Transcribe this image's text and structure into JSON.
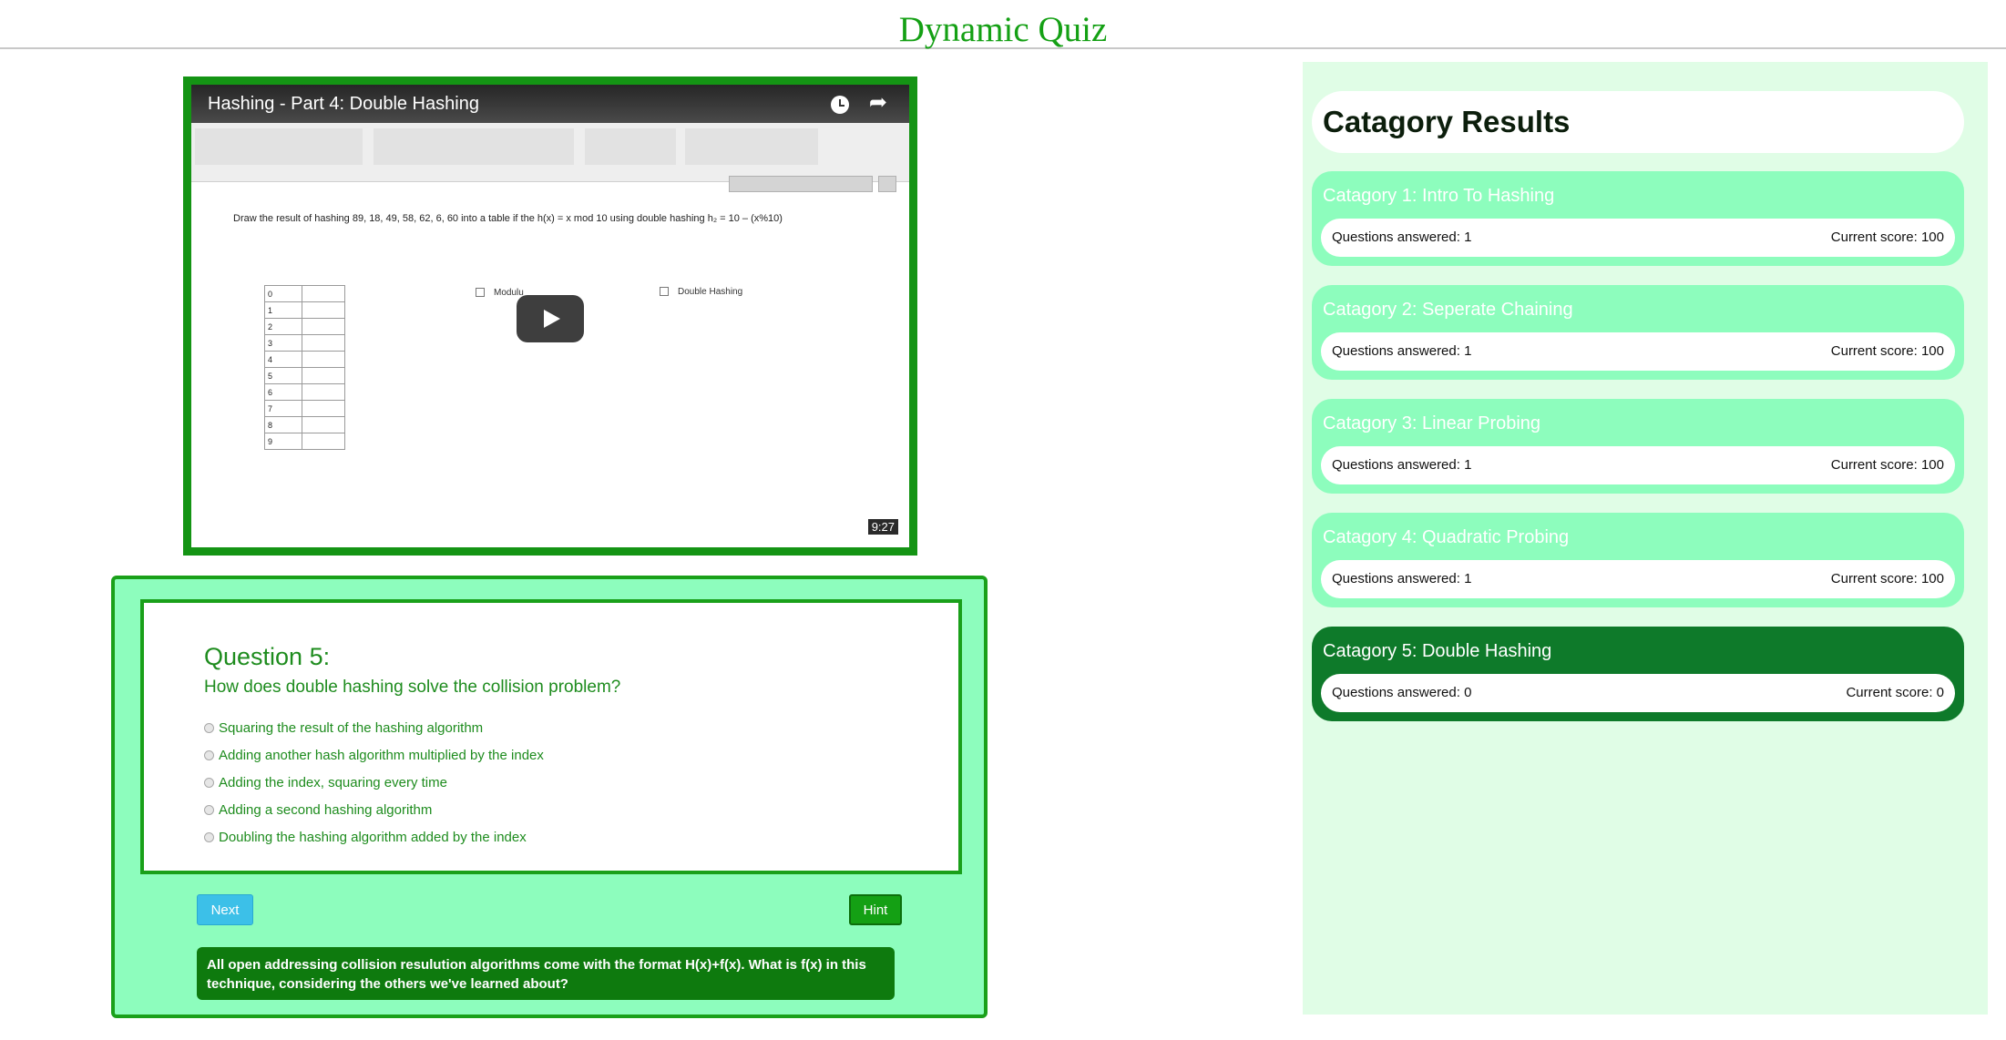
{
  "header": {
    "title": "Dynamic Quiz"
  },
  "video": {
    "title": "Hashing - Part 4: Double Hashing",
    "slide_text": "Draw the result of hashing 89, 18, 49, 58, 62, 6, 60 into a table if the h(x) = x mod 10 using double hashing  h₂ = 10 – (x%10)",
    "table_rows": [
      "0",
      "1",
      "2",
      "3",
      "4",
      "5",
      "6",
      "7",
      "8",
      "9"
    ],
    "label_modulus": "Modulu",
    "label_double_hashing": "Double Hashing",
    "duration": "9:27"
  },
  "quiz": {
    "heading": "Question 5:",
    "question": "How does double hashing solve the collision problem?",
    "answers": [
      "Squaring the result of the hashing algorithm",
      "Adding another hash algorithm multiplied by the index",
      "Adding the index, squaring every time",
      "Adding a second hashing algorithm",
      "Doubling the hashing algorithm added by the index"
    ],
    "next_label": "Next",
    "hint_label": "Hint",
    "hint_text": "All open addressing collision resulution algorithms come with the format H(x)+f(x). What is f(x) in this technique, considering the others we've learned about?"
  },
  "results": {
    "title": "Catagory Results",
    "categories": [
      {
        "name": "Catagory 1: Intro To Hashing",
        "answered": "Questions answered: 1",
        "score": "Current score: 100"
      },
      {
        "name": "Catagory 2: Seperate Chaining",
        "answered": "Questions answered: 1",
        "score": "Current score: 100"
      },
      {
        "name": "Catagory 3: Linear Probing",
        "answered": "Questions answered: 1",
        "score": "Current score: 100"
      },
      {
        "name": "Catagory 4: Quadratic Probing",
        "answered": "Questions answered: 1",
        "score": "Current score: 100"
      },
      {
        "name": "Catagory 5: Double Hashing",
        "answered": "Questions answered: 0",
        "score": "Current score: 0"
      }
    ],
    "active_index": 4
  },
  "colors": {
    "accent_green": "#14a014",
    "panel_mint": "#8dfdbd",
    "dark_green": "#0e7a0e",
    "results_bg": "#e0fde6",
    "next_blue": "#3cc0e8"
  },
  "icons": [
    "clock-icon",
    "share-icon",
    "play-icon"
  ]
}
